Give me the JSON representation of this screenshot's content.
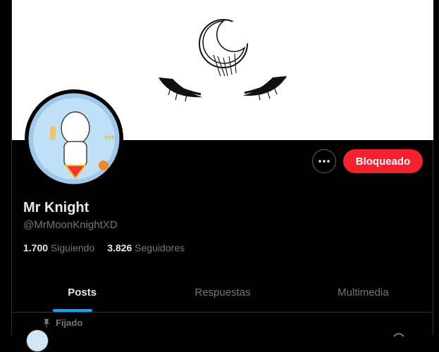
{
  "profile": {
    "display_name": "Mr Knight",
    "handle": "@MrMoonKnightXD",
    "following_count": "1.700",
    "following_label": "Siguiendo",
    "followers_count": "3.826",
    "followers_label": "Seguidores"
  },
  "actions": {
    "more_icon": "more-horizontal-icon",
    "blocked_label": "Bloqueado"
  },
  "tabs": [
    {
      "label": "Posts",
      "active": true
    },
    {
      "label": "Respuestas",
      "active": false
    },
    {
      "label": "Multimedia",
      "active": false
    }
  ],
  "pinned": {
    "icon": "pin-icon",
    "label": "Fijado"
  },
  "colors": {
    "blocked": "#f4212e",
    "accent": "#1d9bf0",
    "background": "#000000",
    "muted": "#71767b"
  }
}
